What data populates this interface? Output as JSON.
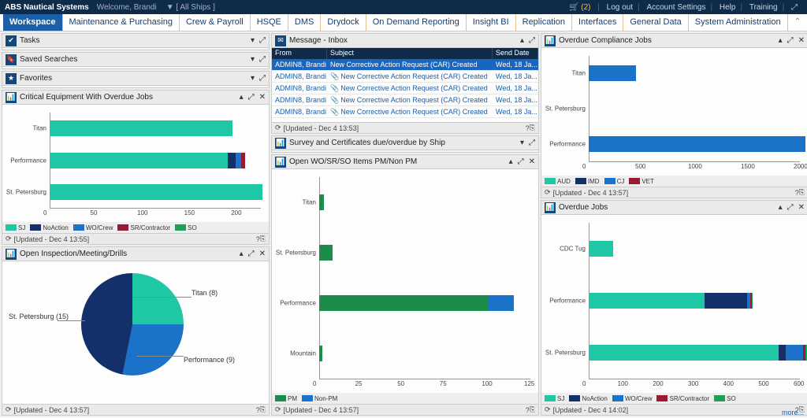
{
  "brand": "ABS Nautical Systems",
  "welcome": "Welcome, Brandi",
  "filter": "[ All Ships ]",
  "cart_count": "(2)",
  "toplinks": [
    "Log out",
    "Account Settings",
    "Help",
    "Training"
  ],
  "tabs": [
    "Workspace",
    "Maintenance & Purchasing",
    "Crew & Payroll",
    "HSQE",
    "DMS",
    "Drydock",
    "On Demand Reporting",
    "Insight BI",
    "Replication",
    "Interfaces",
    "General Data",
    "System Administration"
  ],
  "widgets": {
    "tasks": "Tasks",
    "saved": "Saved Searches",
    "fav": "Favorites",
    "critical": "Critical Equipment With Overdue Jobs",
    "openinsp": "Open Inspection/Meeting/Drills",
    "inbox": "Message - Inbox",
    "survey": "Survey and Certificates due/overdue by Ship",
    "openwo": "Open WO/SR/SO Items PM/Non PM",
    "compliance": "Overdue Compliance Jobs",
    "overdue": "Overdue Jobs"
  },
  "inbox_cols": {
    "from": "From",
    "subject": "Subject",
    "date": "Send Date"
  },
  "inbox_rows": [
    {
      "from": "ADMIN8, Brandi",
      "subj": "New Corrective Action Request (CAR) Created",
      "date": "Wed, 18 Ja...",
      "sel": true,
      "att": false
    },
    {
      "from": "ADMIN8, Brandi",
      "subj": "New Corrective Action Request (CAR) Created",
      "date": "Wed, 18 Ja...",
      "sel": false,
      "att": true
    },
    {
      "from": "ADMIN8, Brandi",
      "subj": "New Corrective Action Request (CAR) Created",
      "date": "Wed, 18 Ja...",
      "sel": false,
      "att": true
    },
    {
      "from": "ADMIN8, Brandi",
      "subj": "New Corrective Action Request (CAR) Created",
      "date": "Wed, 18 Ja...",
      "sel": false,
      "att": true
    },
    {
      "from": "ADMIN8, Brandi",
      "subj": "New Corrective Action Request (CAR) Created",
      "date": "Wed, 18 Ja...",
      "sel": false,
      "att": true
    }
  ],
  "updated": {
    "critical": "[Updated - Dec 4 13:55]",
    "inbox": "[Updated - Dec 4 13:53]",
    "openinsp": "[Updated - Dec 4 13:57]",
    "openwo": "[Updated - Dec 4 13:57]",
    "compliance": "[Updated - Dec 4 13:57]",
    "overdue": "[Updated - Dec 4 14:02]"
  },
  "legends": {
    "critical": [
      {
        "c": "#1fc8a5",
        "t": "SJ"
      },
      {
        "c": "#14306b",
        "t": "NoAction"
      },
      {
        "c": "#1a73c8",
        "t": "WO/Crew"
      },
      {
        "c": "#9c1934",
        "t": "SR/Contractor"
      },
      {
        "c": "#1fa05a",
        "t": "SO"
      }
    ],
    "openwo": [
      {
        "c": "#1d8b4a",
        "t": "PM"
      },
      {
        "c": "#1a73c8",
        "t": "Non-PM"
      }
    ],
    "compliance": [
      {
        "c": "#1fc8a5",
        "t": "AUD"
      },
      {
        "c": "#14306b",
        "t": "IMD"
      },
      {
        "c": "#1a73c8",
        "t": "CJ"
      },
      {
        "c": "#9c1934",
        "t": "VET"
      }
    ],
    "overdue": [
      {
        "c": "#1fc8a5",
        "t": "SJ"
      },
      {
        "c": "#14306b",
        "t": "NoAction"
      },
      {
        "c": "#1a73c8",
        "t": "WO/Crew"
      },
      {
        "c": "#9c1934",
        "t": "SR/Contractor"
      },
      {
        "c": "#1fa05a",
        "t": "SO"
      }
    ]
  },
  "more": "more...",
  "chart_data": [
    {
      "id": "critical",
      "type": "bar",
      "orientation": "h",
      "categories": [
        "Titan",
        "Performance",
        "St. Petersburg"
      ],
      "series": [
        {
          "name": "SJ",
          "values": [
            195,
            190,
            227
          ],
          "color": "#1fc8a5"
        },
        {
          "name": "NoAction",
          "values": [
            0,
            8,
            0
          ],
          "color": "#14306b"
        },
        {
          "name": "WO/Crew",
          "values": [
            0,
            6,
            0
          ],
          "color": "#1a73c8"
        },
        {
          "name": "SR/Contractor",
          "values": [
            0,
            4,
            0
          ],
          "color": "#9c1934"
        },
        {
          "name": "SO",
          "values": [
            0,
            0,
            0
          ],
          "color": "#1fa05a"
        }
      ],
      "xlim": [
        0,
        225
      ],
      "xticks": [
        0,
        50,
        100,
        150,
        200
      ]
    },
    {
      "id": "openinsp",
      "type": "pie",
      "slices": [
        {
          "label": "Titan (8)",
          "value": 8,
          "color": "#1fc8a5"
        },
        {
          "label": "Performance (9)",
          "value": 9,
          "color": "#1a73c8"
        },
        {
          "label": "St. Petersburg (15)",
          "value": 15,
          "color": "#14306b"
        }
      ]
    },
    {
      "id": "openwo",
      "type": "bar",
      "orientation": "h",
      "categories": [
        "Titan",
        "St. Petersburg",
        "Performance",
        "Mountain"
      ],
      "series": [
        {
          "name": "PM",
          "values": [
            3,
            8,
            100,
            2
          ],
          "color": "#1d8b4a"
        },
        {
          "name": "Non-PM",
          "values": [
            0,
            0,
            15,
            0
          ],
          "color": "#1a73c8"
        }
      ],
      "xlim": [
        0,
        125
      ],
      "xticks": [
        0,
        25,
        50,
        75,
        100,
        125
      ]
    },
    {
      "id": "compliance",
      "type": "bar",
      "orientation": "h",
      "categories": [
        "Titan",
        "St. Petersburg",
        "Performance"
      ],
      "series": [
        {
          "name": "AUD",
          "values": [
            0,
            0,
            0
          ],
          "color": "#1fc8a5"
        },
        {
          "name": "IMD",
          "values": [
            0,
            0,
            0
          ],
          "color": "#14306b"
        },
        {
          "name": "CJ",
          "values": [
            450,
            0,
            2050
          ],
          "color": "#1a73c8"
        },
        {
          "name": "VET",
          "values": [
            0,
            0,
            0
          ],
          "color": "#9c1934"
        }
      ],
      "xlim": [
        0,
        2000
      ],
      "xticks": [
        0,
        500,
        1000,
        1500,
        2000
      ]
    },
    {
      "id": "overdue",
      "type": "bar",
      "orientation": "h",
      "categories": [
        "CDC Tug",
        "Performance",
        "St. Petersburg"
      ],
      "series": [
        {
          "name": "SJ",
          "values": [
            70,
            330,
            540
          ],
          "color": "#1fc8a5"
        },
        {
          "name": "NoAction",
          "values": [
            0,
            120,
            20
          ],
          "color": "#14306b"
        },
        {
          "name": "WO/Crew",
          "values": [
            0,
            10,
            50
          ],
          "color": "#1a73c8"
        },
        {
          "name": "SR/Contractor",
          "values": [
            0,
            3,
            5
          ],
          "color": "#9c1934"
        },
        {
          "name": "SO",
          "values": [
            0,
            2,
            15
          ],
          "color": "#1fa05a"
        }
      ],
      "xlim": [
        0,
        600
      ],
      "xticks": [
        0,
        100,
        200,
        300,
        400,
        500,
        600
      ]
    }
  ]
}
